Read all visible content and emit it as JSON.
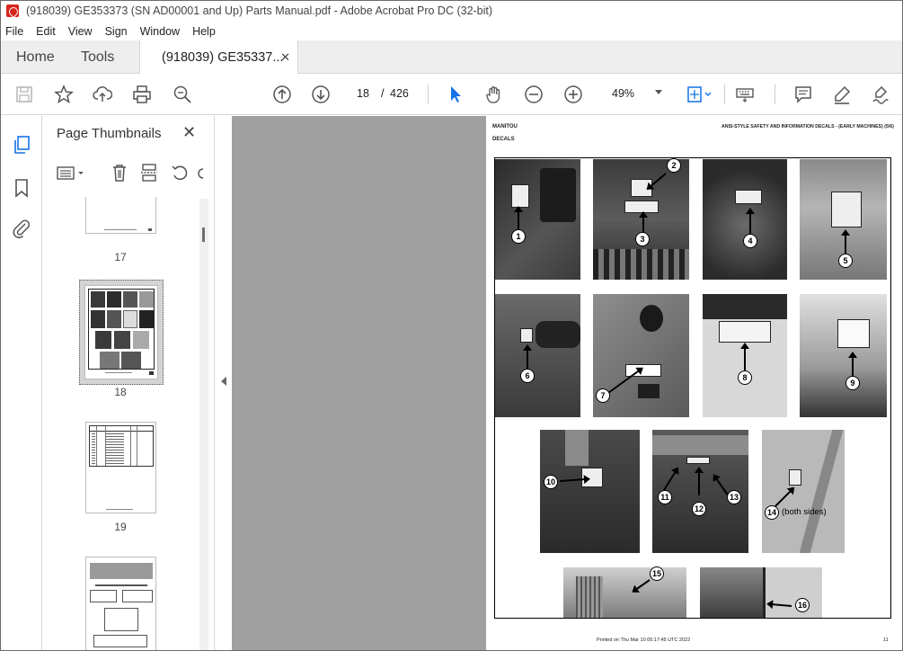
{
  "window": {
    "title": "(918039) GE353373 (SN AD00001 and Up) Parts Manual.pdf - Adobe Acrobat Pro DC (32-bit)"
  },
  "menu": [
    "File",
    "Edit",
    "View",
    "Sign",
    "Window",
    "Help"
  ],
  "tabs": {
    "home": "Home",
    "tools": "Tools",
    "document": "(918039) GE35337..."
  },
  "toolbar": {
    "page_current": "18",
    "page_sep": "/",
    "page_total": "426",
    "zoom": "49%"
  },
  "thumbnails": {
    "title": "Page Thumbnails",
    "pages": [
      {
        "label": "17"
      },
      {
        "label": "18"
      },
      {
        "label": "19"
      },
      {
        "label": ""
      }
    ]
  },
  "page": {
    "brand": "MANITOU",
    "section": "DECALS",
    "header": "ANSI-STYLE SAFETY AND INFORMATION DECALS - (EARLY MACHINES) (5/6)",
    "footer": "Printed on  Thu Mar 10 05:17:45 UTC 2022",
    "number": "11",
    "callouts": [
      "1",
      "2",
      "3",
      "4",
      "5",
      "6",
      "7",
      "8",
      "9",
      "10",
      "11",
      "12",
      "13",
      "14",
      "15",
      "16"
    ],
    "note_14": "(both sides)"
  },
  "colors": {
    "accent_blue": "#1473e6",
    "doc_background": "#a0a0a0",
    "tabbar": "#eeeeee"
  }
}
